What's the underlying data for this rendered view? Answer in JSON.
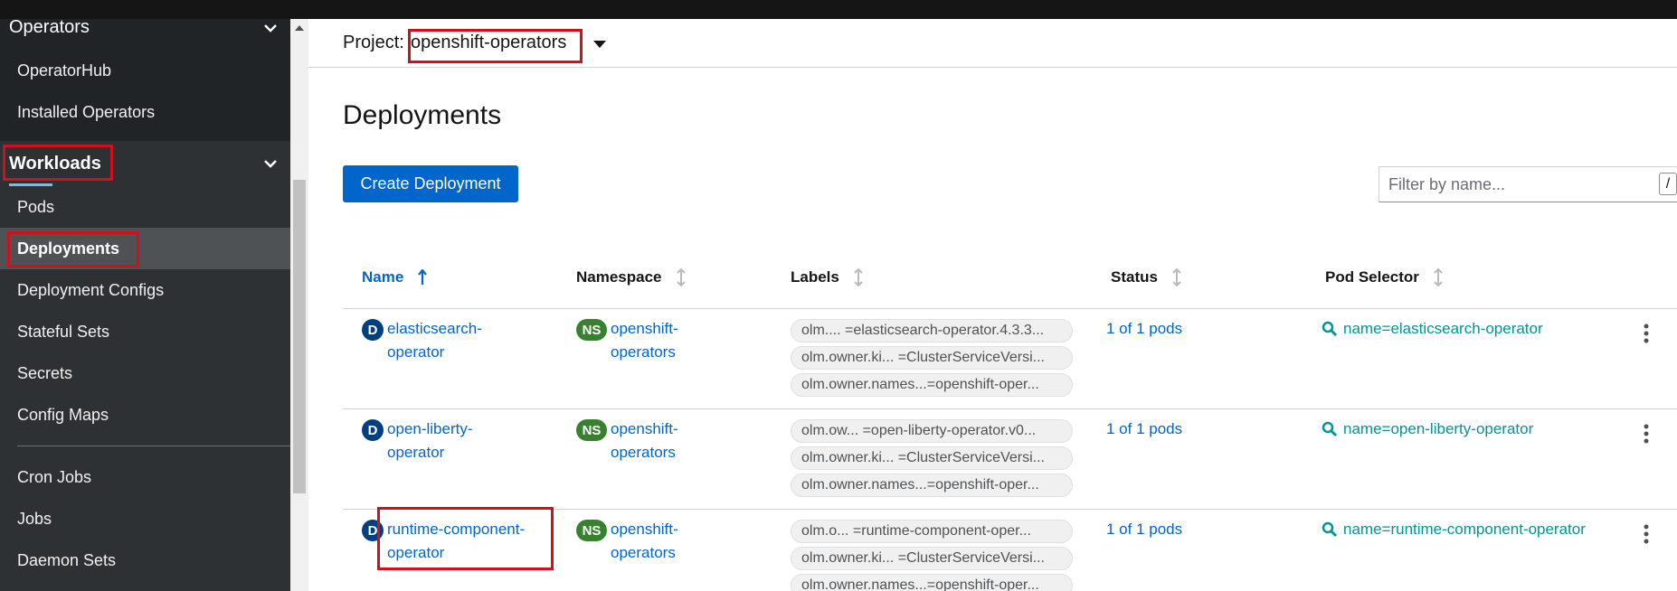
{
  "sidebar": {
    "operators_label": "Operators",
    "operators_items": [
      "OperatorHub",
      "Installed Operators"
    ],
    "workloads_label": "Workloads",
    "workloads_items": [
      "Pods",
      "Deployments",
      "Deployment Configs",
      "Stateful Sets",
      "Secrets",
      "Config Maps",
      "Cron Jobs",
      "Jobs",
      "Daemon Sets"
    ],
    "active_item": "Deployments"
  },
  "project": {
    "label": "Project:",
    "value": "openshift-operators"
  },
  "page": {
    "title": "Deployments",
    "create_button": "Create Deployment",
    "filter_placeholder": "Filter by name...",
    "filter_key": "/"
  },
  "table": {
    "headers": [
      "Name",
      "Namespace",
      "Labels",
      "Status",
      "Pod Selector"
    ],
    "sorted_column": "Name",
    "rows": [
      {
        "badge": "D",
        "name_line1": "elasticsearch-",
        "name_line2": "operator",
        "ns_badge": "NS",
        "namespace_line1": "openshift-",
        "namespace_line2": "operators",
        "labels": [
          "olm.... =elasticsearch-operator.4.3.3...",
          "olm.owner.ki... =ClusterServiceVersi...",
          "olm.owner.names...=openshift-oper..."
        ],
        "status": "1 of 1 pods",
        "pod_selector": "name=elasticsearch-operator"
      },
      {
        "badge": "D",
        "name_line1": "open-liberty-",
        "name_line2": "operator",
        "ns_badge": "NS",
        "namespace_line1": "openshift-",
        "namespace_line2": "operators",
        "labels": [
          "olm.ow... =open-liberty-operator.v0...",
          "olm.owner.ki... =ClusterServiceVersi...",
          "olm.owner.names...=openshift-oper..."
        ],
        "status": "1 of 1 pods",
        "pod_selector": "name=open-liberty-operator"
      },
      {
        "badge": "D",
        "name_line1": "runtime-component-",
        "name_line2": "operator",
        "ns_badge": "NS",
        "namespace_line1": "openshift-",
        "namespace_line2": "operators",
        "labels": [
          "olm.o... =runtime-component-oper...",
          "olm.owner.ki... =ClusterServiceVersi...",
          "olm.owner.names...=openshift-oper..."
        ],
        "status": "1 of 1 pods",
        "pod_selector": "name=runtime-component-operator"
      }
    ]
  },
  "colors": {
    "link": "#0066cc",
    "highlight": "#d0101a",
    "primary_button": "#0066cc",
    "sidebar_bg": "#212427"
  }
}
